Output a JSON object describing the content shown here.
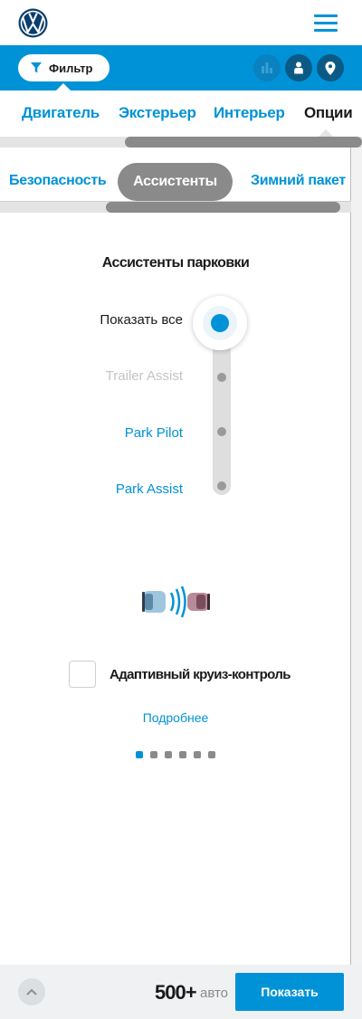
{
  "header": {
    "logo": "vw-logo",
    "menu_icon": "hamburger-icon"
  },
  "toolbar": {
    "filter_label": "Фильтр",
    "filter_icon": "funnel-icon",
    "icons": [
      "compare-chart-icon",
      "dealer-person-icon",
      "location-pin-icon"
    ]
  },
  "main_tabs": [
    {
      "label": "Двигатель",
      "active": false
    },
    {
      "label": "Экстерьер",
      "active": false
    },
    {
      "label": "Интерьер",
      "active": false
    },
    {
      "label": "Опции",
      "active": true
    }
  ],
  "sub_tabs": [
    {
      "label": "Безопасность",
      "active": false
    },
    {
      "label": "Ассистенты",
      "active": true
    },
    {
      "label": "Зимний пакет",
      "active": false
    }
  ],
  "section": {
    "title": "Ассистенты парковки",
    "options": [
      {
        "label": "Показать все",
        "selected": true
      },
      {
        "label": "Trailer Assist",
        "disabled": true
      },
      {
        "label": "Park Pilot"
      },
      {
        "label": "Park Assist"
      }
    ]
  },
  "feature": {
    "illustration": "adaptive-cruise-cars-icon",
    "checkbox_label": "Адаптивный круиз-контроль",
    "checked": false,
    "more_link": "Подробнее"
  },
  "pager": {
    "total": 6,
    "active_index": 0
  },
  "footer": {
    "count": "500+",
    "count_unit": "авто",
    "show_button": "Показать"
  },
  "colors": {
    "accent": "#0092d6",
    "dark_blue": "#0b5a86",
    "grey": "#8a8a8a"
  }
}
